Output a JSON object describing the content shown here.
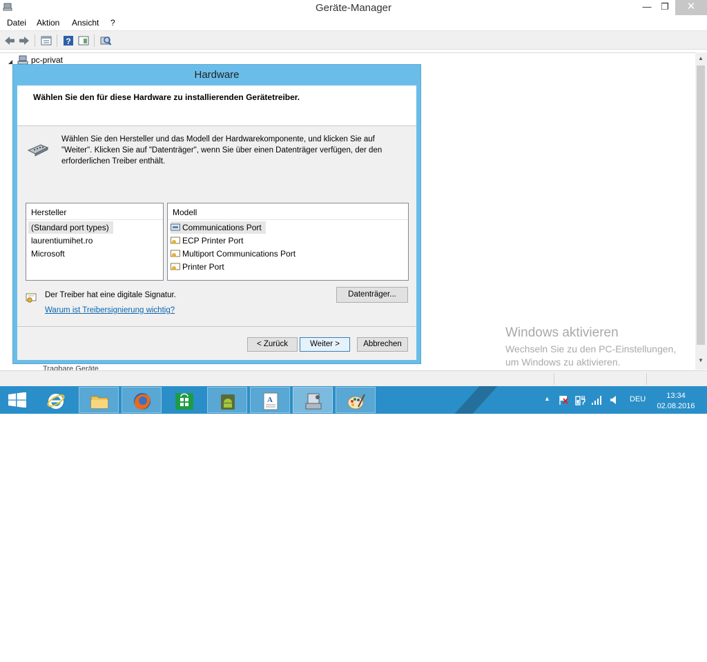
{
  "window": {
    "title": "Geräte-Manager",
    "minimize_glyph": "—",
    "maximize_glyph": "❐",
    "close_glyph": "✕"
  },
  "menu": {
    "datei": "Datei",
    "aktion": "Aktion",
    "ansicht": "Ansicht",
    "help": "?"
  },
  "toolbar": {
    "icons": [
      "back-arrow-icon",
      "forward-arrow-icon",
      "properties-icon",
      "help-icon",
      "show-hide-icon",
      "scan-hardware-icon"
    ]
  },
  "tree": {
    "root_label": "pc-privat",
    "next_label": "Tragbare Geräte"
  },
  "dialog": {
    "title": "Hardware",
    "heading": "Wählen Sie den für diese Hardware zu installierenden Gerätetreiber.",
    "description": "Wählen Sie den Hersteller und das Modell der Hardwarekomponente, und klicken Sie auf \"Weiter\". Klicken Sie auf \"Datenträger\", wenn Sie über einen Datenträger verfügen, der den erforderlichen Treiber enthält.",
    "manufacturer_header": "Hersteller",
    "manufacturers": [
      "(Standard port types)",
      "laurentiumihet.ro",
      "Microsoft"
    ],
    "model_header": "Modell",
    "models": [
      "Communications Port",
      "ECP Printer Port",
      "Multiport Communications Port",
      "Printer Port"
    ],
    "signature_text": "Der Treiber hat eine digitale Signatur.",
    "signature_link": "Warum ist Treibersignierung wichtig?",
    "disk_button": "Datenträger...",
    "back_button": "< Zurück",
    "next_button": "Weiter >",
    "cancel_button": "Abbrechen"
  },
  "watermark": {
    "title": "Windows aktivieren",
    "line1": "Wechseln Sie zu den PC-Einstellungen,",
    "line2": "um Windows zu aktivieren."
  },
  "taskbar": {
    "apps": [
      "internet-explorer-icon",
      "file-explorer-icon",
      "firefox-icon",
      "store-icon",
      "android-icon",
      "wordpad-icon",
      "device-manager-icon",
      "paint-icon"
    ],
    "language": "DEU",
    "time": "13:34",
    "date": "02.08.2016"
  },
  "colors": {
    "dialog_frame": "#6bbde9",
    "taskbar": "#2a8fc8",
    "link": "#0a64ad"
  }
}
